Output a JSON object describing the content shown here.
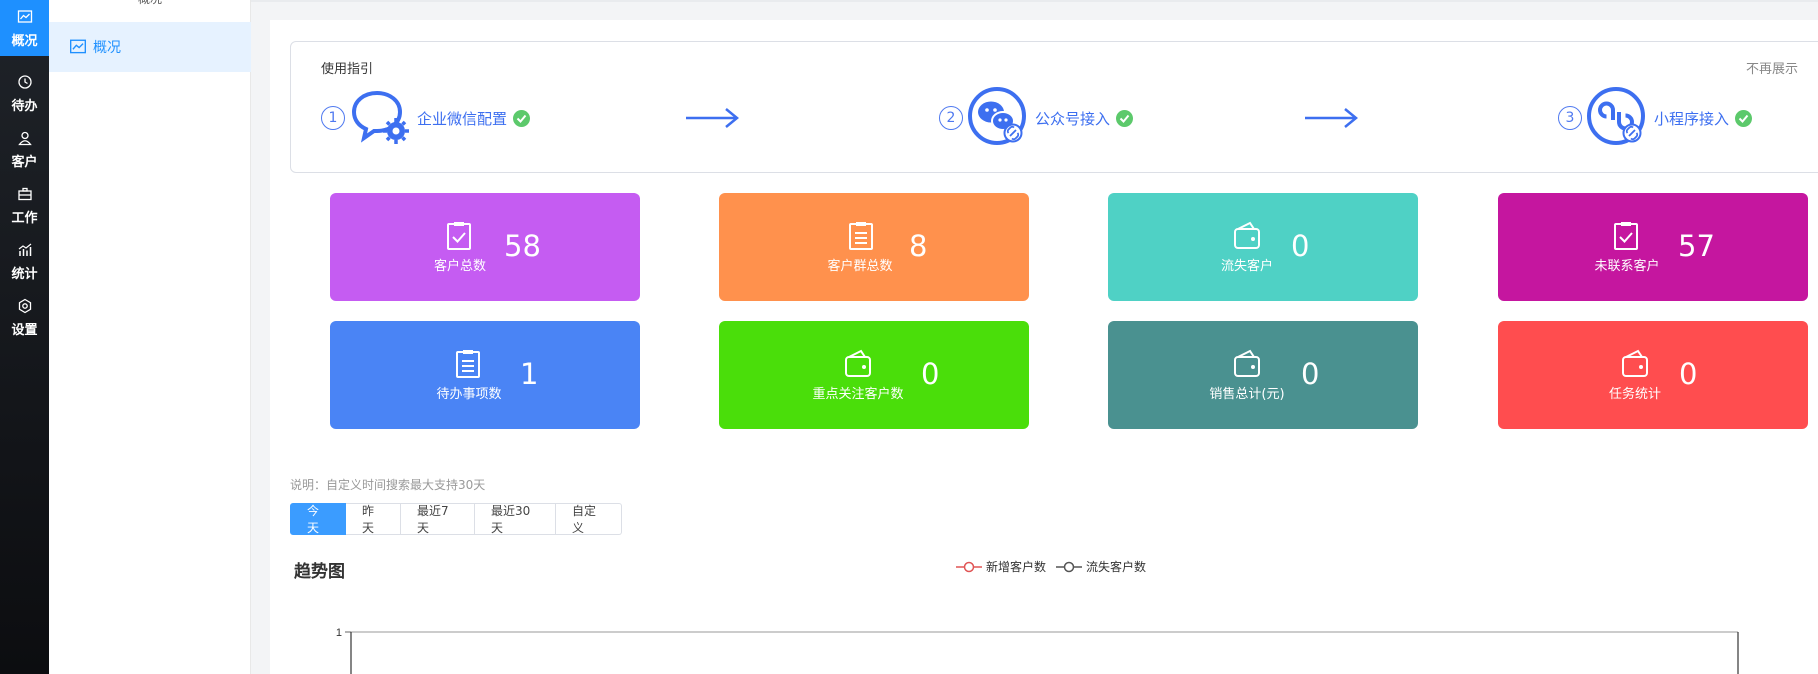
{
  "nav": {
    "items": [
      {
        "label": "概况",
        "icon": "chart-line-icon",
        "active": true
      },
      {
        "label": "待办",
        "icon": "clock-icon",
        "active": false
      },
      {
        "label": "客户",
        "icon": "user-icon",
        "active": false
      },
      {
        "label": "工作",
        "icon": "briefcase-icon",
        "active": false
      },
      {
        "label": "统计",
        "icon": "bar-chart-icon",
        "active": false
      },
      {
        "label": "设置",
        "icon": "gear-icon",
        "active": false
      }
    ]
  },
  "submenu": {
    "header": "概况",
    "item": "概况"
  },
  "guide": {
    "title": "使用指引",
    "hide_label": "不再展示",
    "steps": [
      {
        "num": "1",
        "label": "企业微信配置",
        "icon": "chat-gear-icon"
      },
      {
        "num": "2",
        "label": "公众号接入",
        "icon": "wechat-link-icon"
      },
      {
        "num": "3",
        "label": "小程序接入",
        "icon": "miniprogram-link-icon"
      }
    ]
  },
  "cards": [
    {
      "label": "客户总数",
      "value": "58",
      "color": "#c55cf2",
      "icon": "clipboard-check-icon"
    },
    {
      "label": "客户群总数",
      "value": "8",
      "color": "#ff914d",
      "icon": "clipboard-list-icon"
    },
    {
      "label": "流失客户",
      "value": "0",
      "color": "#4fd1c5",
      "icon": "wallet-icon"
    },
    {
      "label": "未联系客户",
      "value": "57",
      "color": "#c5169f",
      "icon": "clipboard-check-icon"
    },
    {
      "label": "待办事项数",
      "value": "1",
      "color": "#4a84f5",
      "icon": "clipboard-list-icon"
    },
    {
      "label": "重点关注客户数",
      "value": "0",
      "color": "#4ade0a",
      "icon": "wallet-icon"
    },
    {
      "label": "销售总计(元)",
      "value": "0",
      "color": "#4a9190",
      "icon": "wallet-icon"
    },
    {
      "label": "任务统计",
      "value": "0",
      "color": "#ff4d4f",
      "icon": "wallet-icon"
    }
  ],
  "filters": {
    "note": "说明：自定义时间搜索最大支持30天",
    "buttons": [
      "今天",
      "昨天",
      "最近7天",
      "最近30天",
      "自定义"
    ],
    "active": "今天"
  },
  "trend": {
    "title": "趋势图"
  },
  "chart_data": {
    "type": "line",
    "series": [
      {
        "name": "新增客户数",
        "color": "#e05555",
        "values": []
      },
      {
        "name": "流失客户数",
        "color": "#555555",
        "values": []
      }
    ],
    "ylim": [
      0,
      1
    ],
    "y_ticks": [
      "1"
    ]
  }
}
